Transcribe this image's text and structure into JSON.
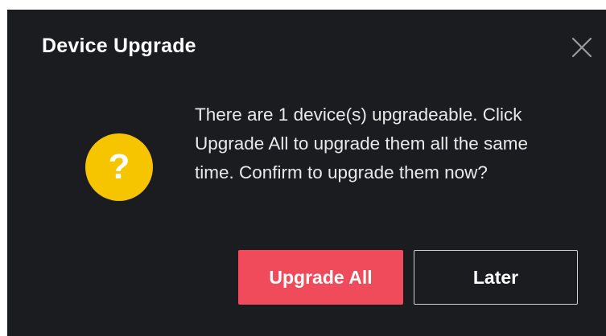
{
  "dialog": {
    "title": "Device Upgrade",
    "message": "There are 1 device(s) upgradeable. Click Upgrade All to upgrade them all the same time. Confirm to upgrade them now?",
    "icon": "question-mark-icon",
    "icon_glyph": "?",
    "close_icon": "close-icon",
    "buttons": {
      "primary_label": "Upgrade All",
      "secondary_label": "Later"
    },
    "colors": {
      "background": "#1a1c20",
      "primary": "#f04b5a",
      "icon": "#f7c500",
      "text": "#e9e9e9"
    }
  }
}
